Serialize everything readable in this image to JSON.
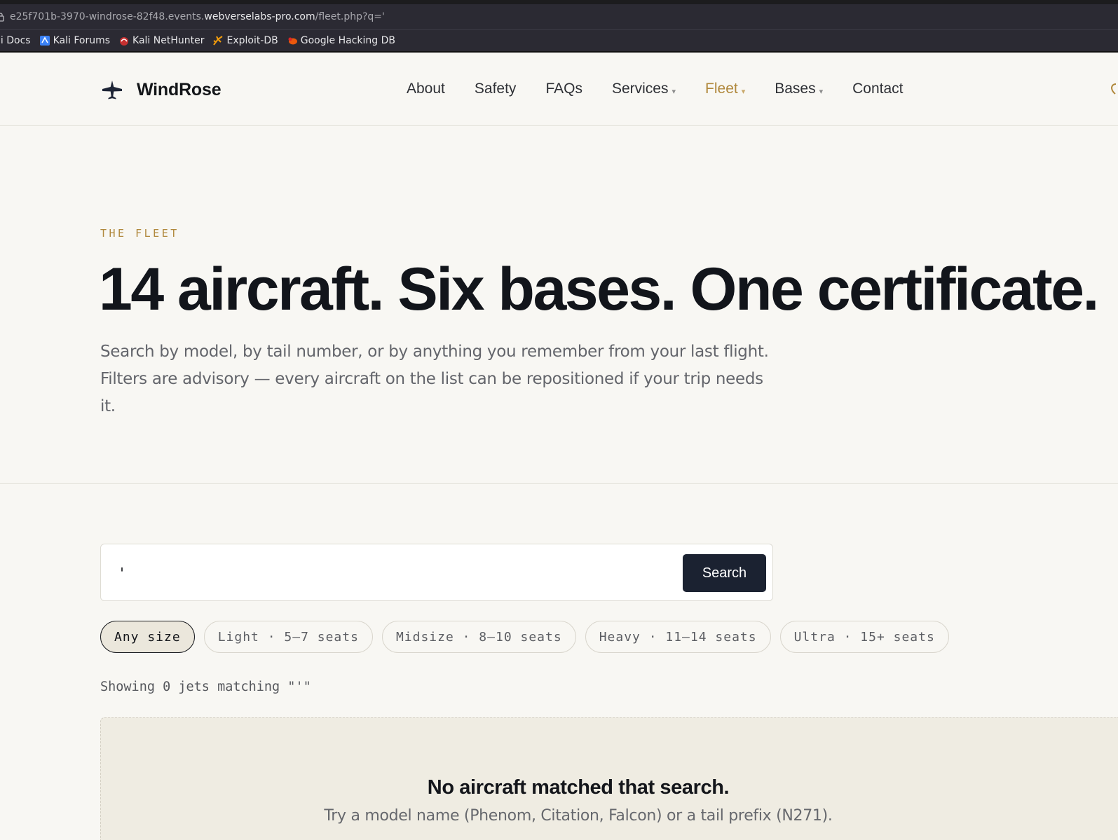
{
  "browser": {
    "url_prefix": "e25f701b-3970-windrose-82f48.events.",
    "url_host": "webverselabs-pro.com",
    "url_path": "/fleet.php?q='",
    "bookmarks": [
      {
        "label": "li Docs",
        "icon": "kali-docs-icon"
      },
      {
        "label": "Kali Forums",
        "icon": "kali-forums-icon"
      },
      {
        "label": "Kali NetHunter",
        "icon": "kali-nethunter-icon"
      },
      {
        "label": "Exploit-DB",
        "icon": "exploit-db-icon"
      },
      {
        "label": "Google Hacking DB",
        "icon": "google-hacking-db-icon"
      }
    ]
  },
  "header": {
    "brand": "WindRose",
    "brand_icon": "airplane-icon",
    "nav": [
      {
        "label": "About",
        "dropdown": false,
        "active": false
      },
      {
        "label": "Safety",
        "dropdown": false,
        "active": false
      },
      {
        "label": "FAQs",
        "dropdown": false,
        "active": false
      },
      {
        "label": "Services",
        "dropdown": true,
        "active": false
      },
      {
        "label": "Fleet",
        "dropdown": true,
        "active": true
      },
      {
        "label": "Bases",
        "dropdown": true,
        "active": false
      },
      {
        "label": "Contact",
        "dropdown": false,
        "active": false
      }
    ],
    "caret": "▾"
  },
  "hero": {
    "eyebrow": "THE FLEET",
    "title": "14 aircraft. Six bases. One certificate.",
    "subtitle": "Search by model, by tail number, or by anything you remember from your last flight. Filters are advisory — every aircraft on the list can be repositioned if your trip needs it."
  },
  "search": {
    "value": "'",
    "button_label": "Search"
  },
  "filters": [
    {
      "label": "Any size",
      "selected": true
    },
    {
      "label": "Light · 5–7 seats",
      "selected": false
    },
    {
      "label": "Midsize · 8–10 seats",
      "selected": false
    },
    {
      "label": "Heavy · 11–14 seats",
      "selected": false
    },
    {
      "label": "Ultra · 15+ seats",
      "selected": false
    }
  ],
  "results": {
    "summary": "Showing 0 jets matching \"'\""
  },
  "empty_state": {
    "title": "No aircraft matched that search.",
    "hint": "Try a model name (Phenom, Citation, Falcon) or a tail prefix (N271)."
  },
  "colors": {
    "accent": "#b0883c",
    "ink": "#12151b",
    "button": "#1b2231",
    "page_bg": "#f8f7f3"
  }
}
